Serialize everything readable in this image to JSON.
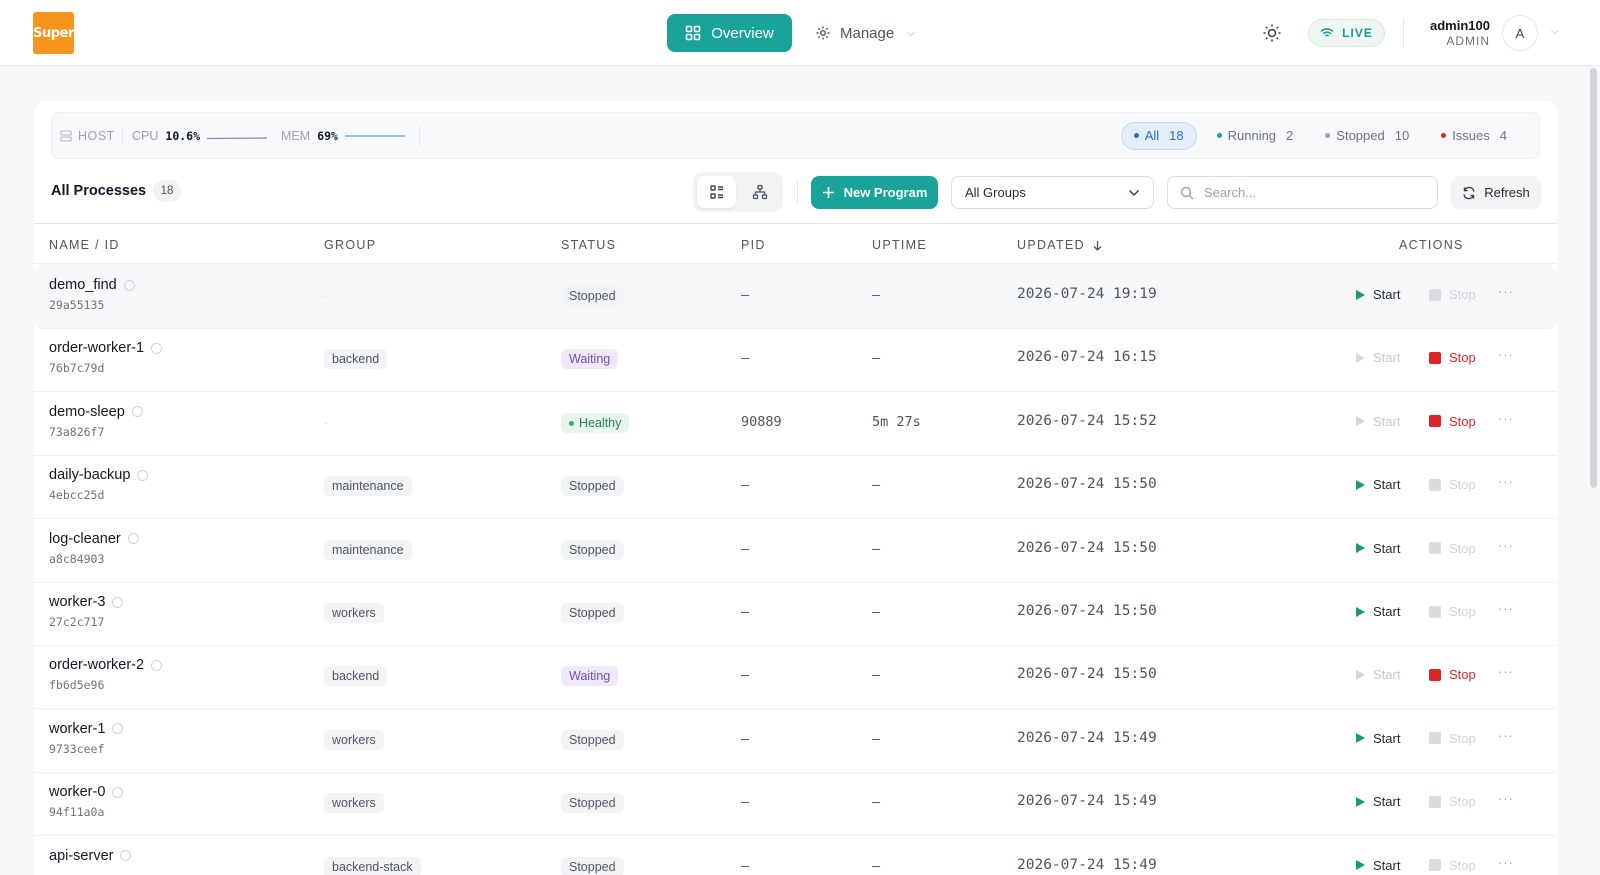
{
  "brand": {
    "logo_text": "Super"
  },
  "nav": {
    "overview_label": "Overview",
    "manage_label": "Manage"
  },
  "header": {
    "live_label": "LIVE",
    "user_name": "admin100",
    "user_role": "ADMIN",
    "avatar_initial": "A"
  },
  "status_bar": {
    "host_label": "HOST",
    "cpu_label": "CPU",
    "cpu_value": "10.6%",
    "mem_label": "MEM",
    "mem_value": "69%",
    "filters": [
      {
        "label": "All",
        "count": "18",
        "dot_color": "#2c6fb3",
        "active": true
      },
      {
        "label": "Running",
        "count": "2",
        "dot_color": "#1aa39a",
        "active": false
      },
      {
        "label": "Stopped",
        "count": "10",
        "dot_color": "#9ca3af",
        "active": false
      },
      {
        "label": "Issues",
        "count": "4",
        "dot_color": "#dc2626",
        "active": false
      }
    ]
  },
  "toolbar": {
    "title": "All Processes",
    "count": "18",
    "new_program_label": "New Program",
    "group_select_value": "All Groups",
    "search_placeholder": "Search...",
    "refresh_label": "Refresh"
  },
  "table": {
    "columns": {
      "name": "NAME / ID",
      "group": "GROUP",
      "status": "STATUS",
      "pid": "PID",
      "uptime": "UPTIME",
      "updated": "UPDATED",
      "actions": "ACTIONS"
    },
    "action_labels": {
      "start": "Start",
      "stop": "Stop",
      "more": "···"
    },
    "empty_group": "-",
    "rows": [
      {
        "name": "demo_find",
        "id": "29a55135",
        "group": "-",
        "status": "Stopped",
        "status_type": "stopped",
        "pid": "–",
        "uptime": "–",
        "updated": "2026-07-24 19:19",
        "can_start": true,
        "can_stop": false
      },
      {
        "name": "order-worker-1",
        "id": "76b7c79d",
        "group": "backend",
        "status": "Waiting",
        "status_type": "waiting",
        "pid": "–",
        "uptime": "–",
        "updated": "2026-07-24 16:15",
        "can_start": false,
        "can_stop": true
      },
      {
        "name": "demo-sleep",
        "id": "73a826f7",
        "group": "-",
        "status": "Healthy",
        "status_type": "healthy",
        "pid": "90889",
        "uptime": "5m 27s",
        "updated": "2026-07-24 15:52",
        "can_start": false,
        "can_stop": true
      },
      {
        "name": "daily-backup",
        "id": "4ebcc25d",
        "group": "maintenance",
        "status": "Stopped",
        "status_type": "stopped",
        "pid": "–",
        "uptime": "–",
        "updated": "2026-07-24 15:50",
        "can_start": true,
        "can_stop": false
      },
      {
        "name": "log-cleaner",
        "id": "a8c84903",
        "group": "maintenance",
        "status": "Stopped",
        "status_type": "stopped",
        "pid": "–",
        "uptime": "–",
        "updated": "2026-07-24 15:50",
        "can_start": true,
        "can_stop": false
      },
      {
        "name": "worker-3",
        "id": "27c2c717",
        "group": "workers",
        "status": "Stopped",
        "status_type": "stopped",
        "pid": "–",
        "uptime": "–",
        "updated": "2026-07-24 15:50",
        "can_start": true,
        "can_stop": false
      },
      {
        "name": "order-worker-2",
        "id": "fb6d5e96",
        "group": "backend",
        "status": "Waiting",
        "status_type": "waiting",
        "pid": "–",
        "uptime": "–",
        "updated": "2026-07-24 15:50",
        "can_start": false,
        "can_stop": true
      },
      {
        "name": "worker-1",
        "id": "9733ceef",
        "group": "workers",
        "status": "Stopped",
        "status_type": "stopped",
        "pid": "–",
        "uptime": "–",
        "updated": "2026-07-24 15:49",
        "can_start": true,
        "can_stop": false
      },
      {
        "name": "worker-0",
        "id": "94f11a0a",
        "group": "workers",
        "status": "Stopped",
        "status_type": "stopped",
        "pid": "–",
        "uptime": "–",
        "updated": "2026-07-24 15:49",
        "can_start": true,
        "can_stop": false
      },
      {
        "name": "api-server",
        "id": "",
        "group": "backend-stack",
        "status": "Stopped",
        "status_type": "stopped",
        "pid": "–",
        "uptime": "–",
        "updated": "2026-07-24 15:49",
        "can_start": true,
        "can_stop": false
      }
    ]
  }
}
